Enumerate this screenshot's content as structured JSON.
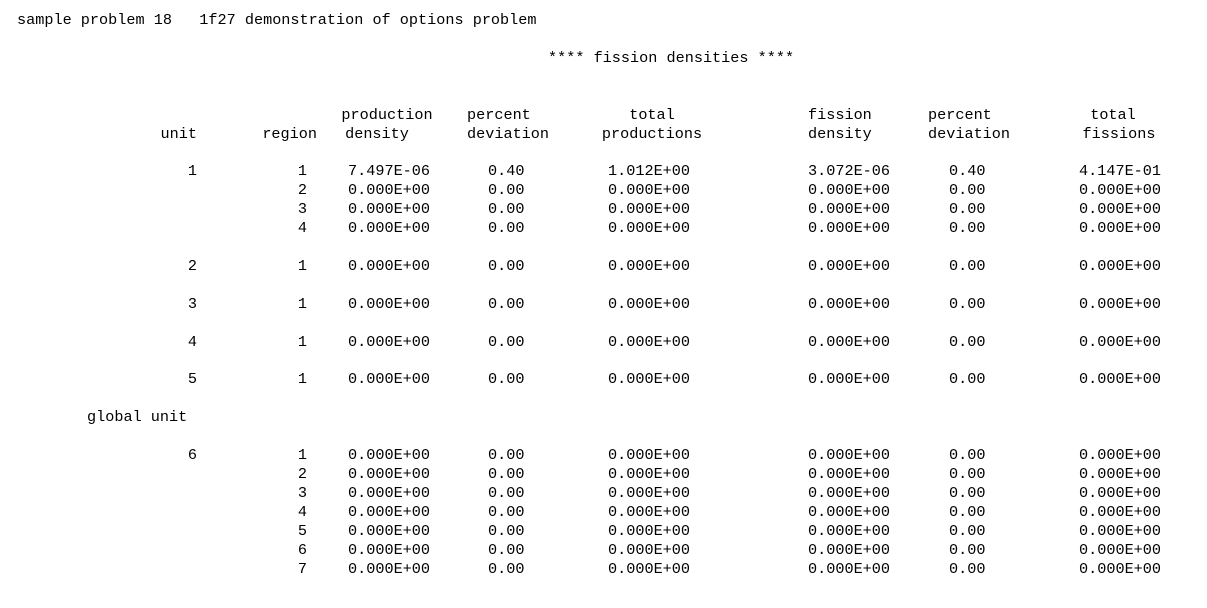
{
  "header": {
    "problem_title": "sample problem 18   1f27 demonstration of options problem",
    "section_title": "**** fission densities ****"
  },
  "columns": {
    "unit": "unit",
    "region": "region",
    "production_density": [
      "production",
      "density"
    ],
    "production_deviation": [
      "percent",
      "deviation"
    ],
    "total_productions": [
      "total",
      "productions"
    ],
    "fission_density": [
      "fission",
      "density"
    ],
    "fission_deviation": [
      "percent",
      "deviation"
    ],
    "total_fissions": [
      "total",
      "fissions"
    ]
  },
  "global_unit_label": "global unit",
  "rows": [
    {
      "unit": "1",
      "region": "1",
      "prod_density": "7.497E-06",
      "prod_dev": "0.40",
      "total_prod": "1.012E+00",
      "fis_density": "3.072E-06",
      "fis_dev": "0.40",
      "total_fis": "4.147E-01"
    },
    {
      "unit": "",
      "region": "2",
      "prod_density": "0.000E+00",
      "prod_dev": "0.00",
      "total_prod": "0.000E+00",
      "fis_density": "0.000E+00",
      "fis_dev": "0.00",
      "total_fis": "0.000E+00"
    },
    {
      "unit": "",
      "region": "3",
      "prod_density": "0.000E+00",
      "prod_dev": "0.00",
      "total_prod": "0.000E+00",
      "fis_density": "0.000E+00",
      "fis_dev": "0.00",
      "total_fis": "0.000E+00"
    },
    {
      "unit": "",
      "region": "4",
      "prod_density": "0.000E+00",
      "prod_dev": "0.00",
      "total_prod": "0.000E+00",
      "fis_density": "0.000E+00",
      "fis_dev": "0.00",
      "total_fis": "0.000E+00"
    },
    {
      "unit": "2",
      "region": "1",
      "prod_density": "0.000E+00",
      "prod_dev": "0.00",
      "total_prod": "0.000E+00",
      "fis_density": "0.000E+00",
      "fis_dev": "0.00",
      "total_fis": "0.000E+00"
    },
    {
      "unit": "3",
      "region": "1",
      "prod_density": "0.000E+00",
      "prod_dev": "0.00",
      "total_prod": "0.000E+00",
      "fis_density": "0.000E+00",
      "fis_dev": "0.00",
      "total_fis": "0.000E+00"
    },
    {
      "unit": "4",
      "region": "1",
      "prod_density": "0.000E+00",
      "prod_dev": "0.00",
      "total_prod": "0.000E+00",
      "fis_density": "0.000E+00",
      "fis_dev": "0.00",
      "total_fis": "0.000E+00"
    },
    {
      "unit": "5",
      "region": "1",
      "prod_density": "0.000E+00",
      "prod_dev": "0.00",
      "total_prod": "0.000E+00",
      "fis_density": "0.000E+00",
      "fis_dev": "0.00",
      "total_fis": "0.000E+00"
    },
    {
      "unit": "6",
      "region": "1",
      "prod_density": "0.000E+00",
      "prod_dev": "0.00",
      "total_prod": "0.000E+00",
      "fis_density": "0.000E+00",
      "fis_dev": "0.00",
      "total_fis": "0.000E+00"
    },
    {
      "unit": "",
      "region": "2",
      "prod_density": "0.000E+00",
      "prod_dev": "0.00",
      "total_prod": "0.000E+00",
      "fis_density": "0.000E+00",
      "fis_dev": "0.00",
      "total_fis": "0.000E+00"
    },
    {
      "unit": "",
      "region": "3",
      "prod_density": "0.000E+00",
      "prod_dev": "0.00",
      "total_prod": "0.000E+00",
      "fis_density": "0.000E+00",
      "fis_dev": "0.00",
      "total_fis": "0.000E+00"
    },
    {
      "unit": "",
      "region": "4",
      "prod_density": "0.000E+00",
      "prod_dev": "0.00",
      "total_prod": "0.000E+00",
      "fis_density": "0.000E+00",
      "fis_dev": "0.00",
      "total_fis": "0.000E+00"
    },
    {
      "unit": "",
      "region": "5",
      "prod_density": "0.000E+00",
      "prod_dev": "0.00",
      "total_prod": "0.000E+00",
      "fis_density": "0.000E+00",
      "fis_dev": "0.00",
      "total_fis": "0.000E+00"
    },
    {
      "unit": "",
      "region": "6",
      "prod_density": "0.000E+00",
      "prod_dev": "0.00",
      "total_prod": "0.000E+00",
      "fis_density": "0.000E+00",
      "fis_dev": "0.00",
      "total_fis": "0.000E+00"
    },
    {
      "unit": "",
      "region": "7",
      "prod_density": "0.000E+00",
      "prod_dev": "0.00",
      "total_prod": "0.000E+00",
      "fis_density": "0.000E+00",
      "fis_dev": "0.00",
      "total_fis": "0.000E+00"
    }
  ]
}
